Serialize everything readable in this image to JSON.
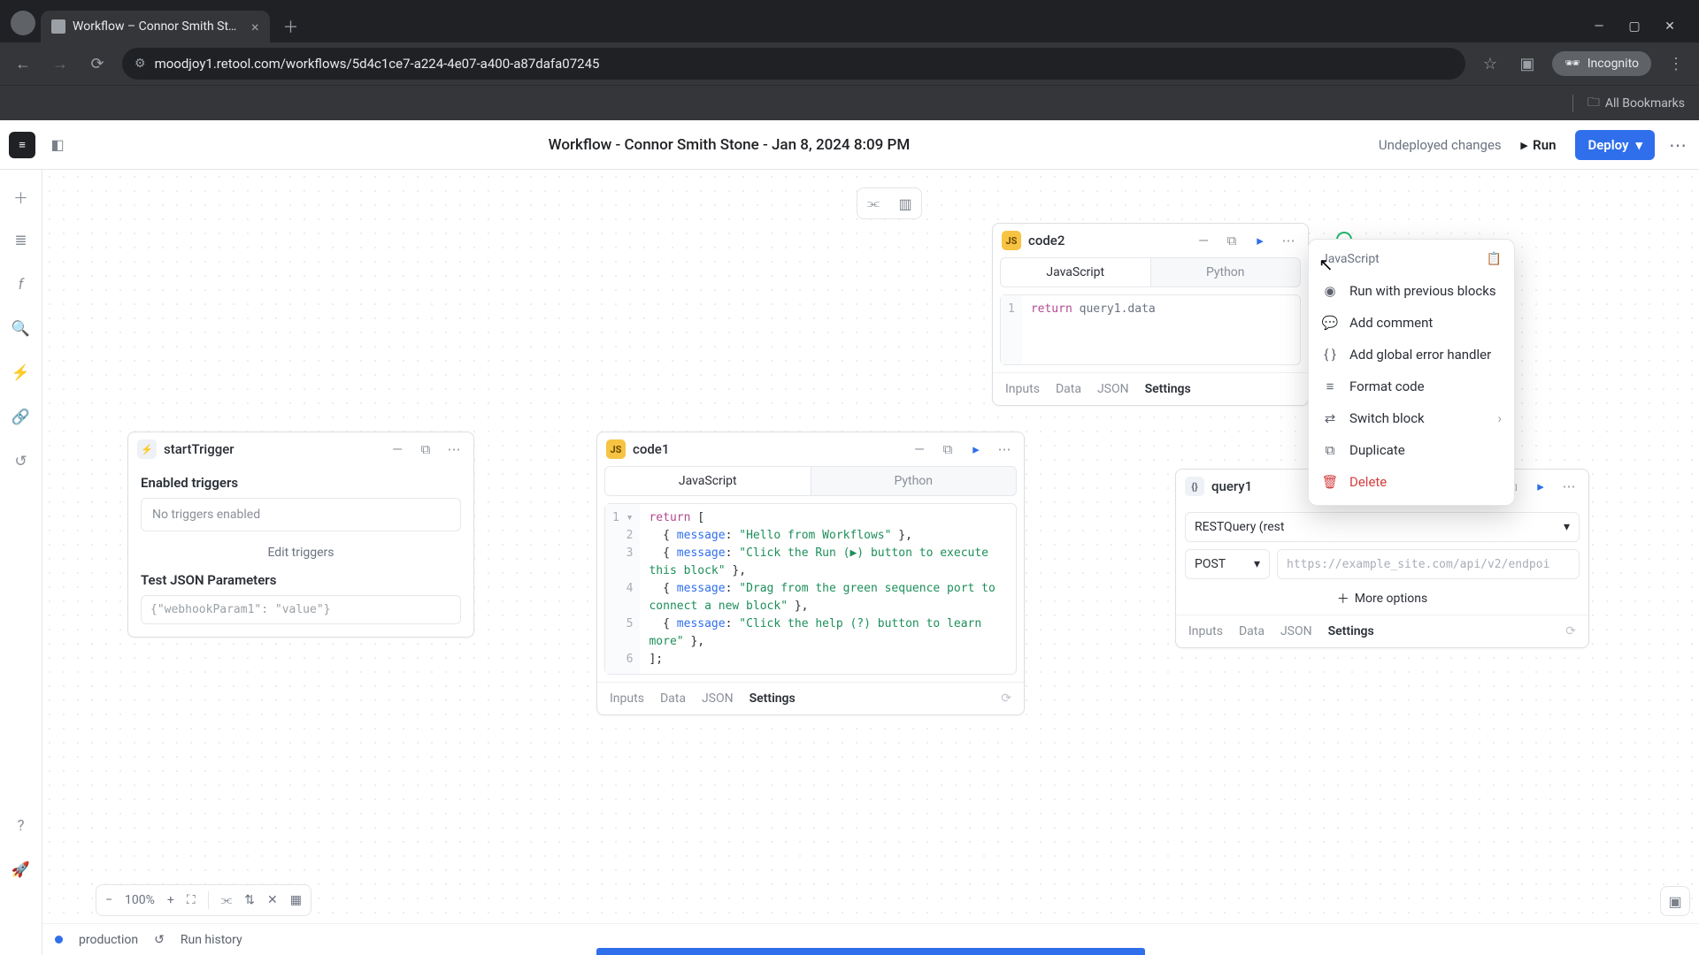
{
  "browser": {
    "tab_title": "Workflow – Connor Smith Sto…",
    "url": "moodjoy1.retool.com/workflows/5d4c1ce7-a224-4e07-a400-a87dafa07245",
    "incognito_label": "Incognito",
    "all_bookmarks": "All Bookmarks"
  },
  "header": {
    "title": "Workflow - Connor Smith Stone - Jan 8, 2024 8:09 PM",
    "undeployed": "Undeployed changes",
    "run": "Run",
    "deploy": "Deploy"
  },
  "trigger": {
    "name": "startTrigger",
    "enabled_label": "Enabled triggers",
    "none": "No triggers enabled",
    "edit": "Edit triggers",
    "params_label": "Test JSON Parameters",
    "params_value": "{\"webhookParam1\": \"value\"}"
  },
  "code1": {
    "name": "code1",
    "js": "JavaScript",
    "py": "Python",
    "lines": [
      "1 ▾",
      "2",
      "3",
      "4",
      "5",
      "6"
    ],
    "l1a": "return",
    "l1b": " [",
    "l2a": "  { ",
    "l2b": "message",
    "l2c": ": ",
    "l2d": "\"Hello from Workflows\"",
    "l2e": " },",
    "l3a": "  { ",
    "l3b": "message",
    "l3c": ": ",
    "l3d": "\"Click the Run (▶) button to execute",
    "l3e": "this block\"",
    "l3f": " },",
    "l4a": "  { ",
    "l4b": "message",
    "l4c": ": ",
    "l4d": "\"Drag from the green sequence port to",
    "l4e": "connect a new block\"",
    "l4f": " },",
    "l5a": "  { ",
    "l5b": "message",
    "l5c": ": ",
    "l5d": "\"Click the help (?) button to learn",
    "l5e": "more\"",
    "l5f": " },",
    "l6": "];"
  },
  "code2": {
    "name": "code2",
    "js": "JavaScript",
    "py": "Python",
    "line_no": "1",
    "kw": "return",
    "rest": " query1.data"
  },
  "query1": {
    "name": "query1",
    "rest_label": "RESTQuery (rest",
    "method": "POST",
    "url_placeholder": "https://example_site.com/api/v2/endpoi",
    "more": "More options"
  },
  "footer_tabs": {
    "inputs": "Inputs",
    "data": "Data",
    "json": "JSON",
    "settings": "Settings"
  },
  "ctx": {
    "header": "JavaScript",
    "items": [
      "Run with previous blocks",
      "Add comment",
      "Add global error handler",
      "Format code",
      "Switch block",
      "Duplicate",
      "Delete"
    ]
  },
  "zoom": {
    "value": "100%"
  },
  "status": {
    "env": "production",
    "history": "Run history"
  }
}
